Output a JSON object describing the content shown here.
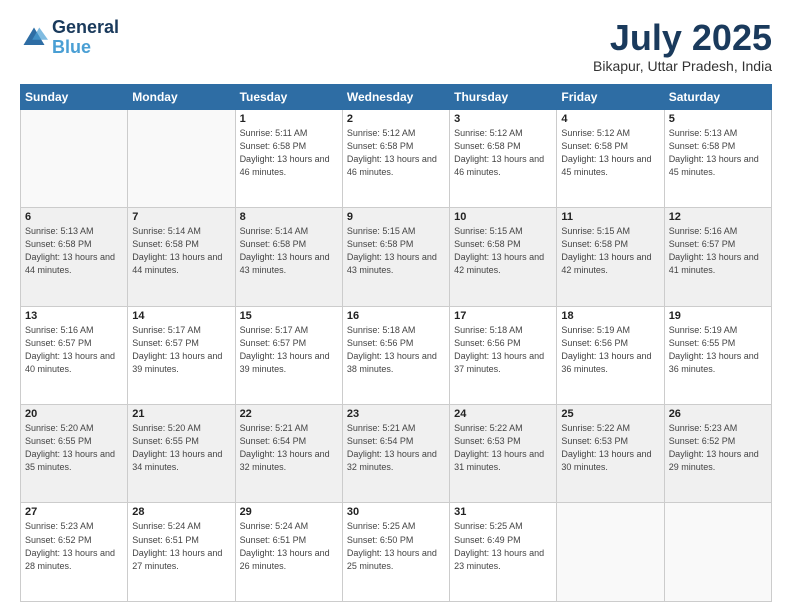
{
  "header": {
    "logo_line1": "General",
    "logo_line2": "Blue",
    "month_title": "July 2025",
    "location": "Bikapur, Uttar Pradesh, India"
  },
  "days_of_week": [
    "Sunday",
    "Monday",
    "Tuesday",
    "Wednesday",
    "Thursday",
    "Friday",
    "Saturday"
  ],
  "weeks": [
    [
      {
        "day": "",
        "text": ""
      },
      {
        "day": "",
        "text": ""
      },
      {
        "day": "1",
        "text": "Sunrise: 5:11 AM\nSunset: 6:58 PM\nDaylight: 13 hours and 46 minutes."
      },
      {
        "day": "2",
        "text": "Sunrise: 5:12 AM\nSunset: 6:58 PM\nDaylight: 13 hours and 46 minutes."
      },
      {
        "day": "3",
        "text": "Sunrise: 5:12 AM\nSunset: 6:58 PM\nDaylight: 13 hours and 46 minutes."
      },
      {
        "day": "4",
        "text": "Sunrise: 5:12 AM\nSunset: 6:58 PM\nDaylight: 13 hours and 45 minutes."
      },
      {
        "day": "5",
        "text": "Sunrise: 5:13 AM\nSunset: 6:58 PM\nDaylight: 13 hours and 45 minutes."
      }
    ],
    [
      {
        "day": "6",
        "text": "Sunrise: 5:13 AM\nSunset: 6:58 PM\nDaylight: 13 hours and 44 minutes."
      },
      {
        "day": "7",
        "text": "Sunrise: 5:14 AM\nSunset: 6:58 PM\nDaylight: 13 hours and 44 minutes."
      },
      {
        "day": "8",
        "text": "Sunrise: 5:14 AM\nSunset: 6:58 PM\nDaylight: 13 hours and 43 minutes."
      },
      {
        "day": "9",
        "text": "Sunrise: 5:15 AM\nSunset: 6:58 PM\nDaylight: 13 hours and 43 minutes."
      },
      {
        "day": "10",
        "text": "Sunrise: 5:15 AM\nSunset: 6:58 PM\nDaylight: 13 hours and 42 minutes."
      },
      {
        "day": "11",
        "text": "Sunrise: 5:15 AM\nSunset: 6:58 PM\nDaylight: 13 hours and 42 minutes."
      },
      {
        "day": "12",
        "text": "Sunrise: 5:16 AM\nSunset: 6:57 PM\nDaylight: 13 hours and 41 minutes."
      }
    ],
    [
      {
        "day": "13",
        "text": "Sunrise: 5:16 AM\nSunset: 6:57 PM\nDaylight: 13 hours and 40 minutes."
      },
      {
        "day": "14",
        "text": "Sunrise: 5:17 AM\nSunset: 6:57 PM\nDaylight: 13 hours and 39 minutes."
      },
      {
        "day": "15",
        "text": "Sunrise: 5:17 AM\nSunset: 6:57 PM\nDaylight: 13 hours and 39 minutes."
      },
      {
        "day": "16",
        "text": "Sunrise: 5:18 AM\nSunset: 6:56 PM\nDaylight: 13 hours and 38 minutes."
      },
      {
        "day": "17",
        "text": "Sunrise: 5:18 AM\nSunset: 6:56 PM\nDaylight: 13 hours and 37 minutes."
      },
      {
        "day": "18",
        "text": "Sunrise: 5:19 AM\nSunset: 6:56 PM\nDaylight: 13 hours and 36 minutes."
      },
      {
        "day": "19",
        "text": "Sunrise: 5:19 AM\nSunset: 6:55 PM\nDaylight: 13 hours and 36 minutes."
      }
    ],
    [
      {
        "day": "20",
        "text": "Sunrise: 5:20 AM\nSunset: 6:55 PM\nDaylight: 13 hours and 35 minutes."
      },
      {
        "day": "21",
        "text": "Sunrise: 5:20 AM\nSunset: 6:55 PM\nDaylight: 13 hours and 34 minutes."
      },
      {
        "day": "22",
        "text": "Sunrise: 5:21 AM\nSunset: 6:54 PM\nDaylight: 13 hours and 32 minutes."
      },
      {
        "day": "23",
        "text": "Sunrise: 5:21 AM\nSunset: 6:54 PM\nDaylight: 13 hours and 32 minutes."
      },
      {
        "day": "24",
        "text": "Sunrise: 5:22 AM\nSunset: 6:53 PM\nDaylight: 13 hours and 31 minutes."
      },
      {
        "day": "25",
        "text": "Sunrise: 5:22 AM\nSunset: 6:53 PM\nDaylight: 13 hours and 30 minutes."
      },
      {
        "day": "26",
        "text": "Sunrise: 5:23 AM\nSunset: 6:52 PM\nDaylight: 13 hours and 29 minutes."
      }
    ],
    [
      {
        "day": "27",
        "text": "Sunrise: 5:23 AM\nSunset: 6:52 PM\nDaylight: 13 hours and 28 minutes."
      },
      {
        "day": "28",
        "text": "Sunrise: 5:24 AM\nSunset: 6:51 PM\nDaylight: 13 hours and 27 minutes."
      },
      {
        "day": "29",
        "text": "Sunrise: 5:24 AM\nSunset: 6:51 PM\nDaylight: 13 hours and 26 minutes."
      },
      {
        "day": "30",
        "text": "Sunrise: 5:25 AM\nSunset: 6:50 PM\nDaylight: 13 hours and 25 minutes."
      },
      {
        "day": "31",
        "text": "Sunrise: 5:25 AM\nSunset: 6:49 PM\nDaylight: 13 hours and 23 minutes."
      },
      {
        "day": "",
        "text": ""
      },
      {
        "day": "",
        "text": ""
      }
    ]
  ]
}
